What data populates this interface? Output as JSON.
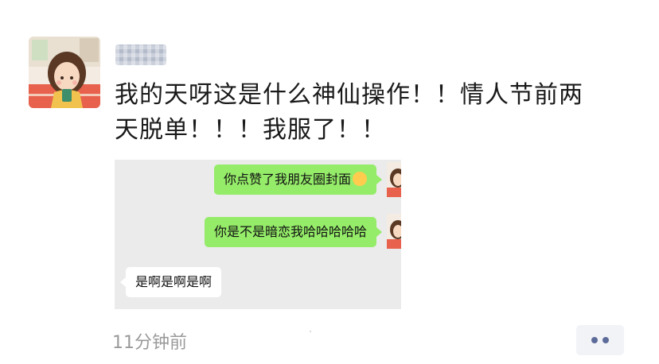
{
  "post": {
    "username": "用户",
    "text_line1": "我的天呀这是什么神仙操作！！情人节前两",
    "text_line2": "天脱单！！！我服了！！",
    "time": "11分钟前"
  },
  "screenshot": {
    "messages": [
      {
        "side": "right",
        "text": "你点赞了我朋友圈封面",
        "emoji": "smiling-face-emoji"
      },
      {
        "side": "right",
        "text": "你是不是暗恋我哈哈哈哈哈"
      },
      {
        "side": "left",
        "text": "是啊是啊是啊"
      }
    ]
  },
  "colors": {
    "green_bubble": "#95ec69",
    "white_bubble": "#ffffff",
    "chat_background": "#ebebeb",
    "dots": "#5c6b99"
  }
}
